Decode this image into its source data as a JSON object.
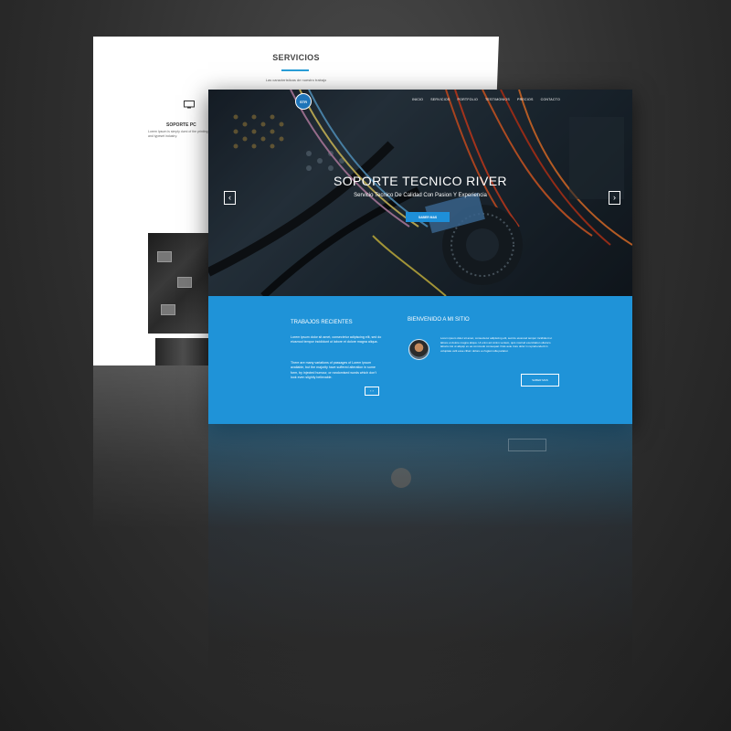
{
  "back_page": {
    "title": "SERVICIOS",
    "subtitle": "Las caracteristicas de nuestro trabajo",
    "service_title": "SOPORTE PC",
    "service_text": "Lorem Ipsum is simply dumi of the printing and typeset industry."
  },
  "front_page": {
    "logo_text": "STR",
    "nav": [
      "INICIO",
      "SERVICIOS",
      "PORTFOLIO",
      "TESTIMONIOS",
      "PRECIOS",
      "CONTACTO"
    ],
    "hero_title": "SOPORTE TECNICO RIVER",
    "hero_subtitle": "Servicio Tecnico De Calidad Con Pasion Y Experiencia",
    "hero_button": "SABER MAS",
    "arrow_left": "‹",
    "arrow_right": "›",
    "trabajos": {
      "title": "TRABAJOS RECIENTES",
      "text1": "Lorem ipsum dolor sit amet, consectetur adipiscing elit, sed do eiusmod tempor incididunt ut labore et dolore magna aliqua.",
      "text2": "There are many variations of passages of Lorem Ipsum available, but the majority have suffered alteration in some form, by injected humour, or randomised words which don't look even slightly believable.",
      "arrows": "‹ ›"
    },
    "bienvenido": {
      "title": "BIENVENIDO A MI SITIO",
      "text": "Lorem ipsum dolor sit amet, consectetur adipiscing elit, sed do eiusmod tempor incididunt ut labore et dolore magna aliqua. Ut enim ad minim veniam, quis nostrud exercitation ullamco laboris nisi ut aliquip ex ea commodo consequat. Duis aute irure dolor in reprehenderit in voluptate velit esse cillum dolore eu fugiat nulla pariatur.",
      "button": "SABER MAS"
    }
  },
  "colors": {
    "accent_blue": "#1f93d8",
    "background": "#2e2e2e"
  }
}
